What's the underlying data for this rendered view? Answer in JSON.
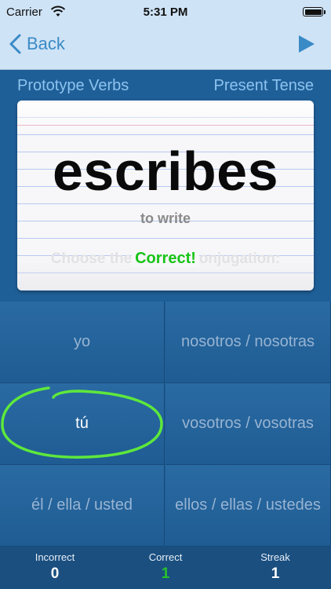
{
  "status": {
    "carrier": "Carrier",
    "time": "5:31 PM"
  },
  "nav": {
    "back_label": "Back"
  },
  "deck": {
    "name": "Prototype Verbs",
    "tense": "Present Tense"
  },
  "card": {
    "word": "escribes",
    "meaning": "to write",
    "prompt": "Choose the correct conjugation:",
    "feedback": "Correct!"
  },
  "options": [
    {
      "label": "yo"
    },
    {
      "label": "nosotros / nosotras"
    },
    {
      "label": "tú"
    },
    {
      "label": "vosotros / vosotras"
    },
    {
      "label": "él / ella / usted"
    },
    {
      "label": "ellos / ellas / ustedes"
    }
  ],
  "score": {
    "incorrect_label": "Incorrect",
    "incorrect": "0",
    "correct_label": "Correct",
    "correct": "1",
    "streak_label": "Streak",
    "streak": "1"
  },
  "colors": {
    "accent": "#3a8ac6",
    "correct_green": "#17c417",
    "circle": "#5ee83c"
  },
  "icons": [
    "wifi-icon",
    "battery-icon",
    "back-chevron-icon",
    "play-icon"
  ]
}
